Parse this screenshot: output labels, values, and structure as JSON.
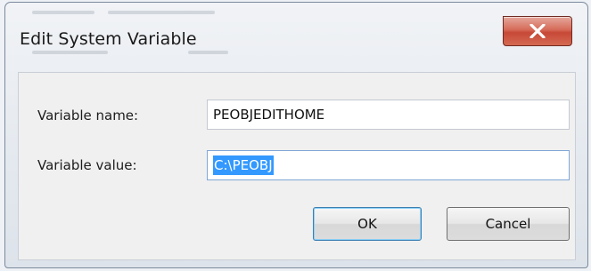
{
  "dialog": {
    "title": "Edit System Variable",
    "close_icon": "close-icon"
  },
  "form": {
    "name_label": "Variable name:",
    "name_value": "PEOBJEDITHOME",
    "value_label": "Variable value:",
    "value_value": "C:\\PEOBJ"
  },
  "buttons": {
    "ok": "OK",
    "cancel": "Cancel"
  },
  "colors": {
    "selection": "#3399ff",
    "close_button": "#c74836"
  }
}
